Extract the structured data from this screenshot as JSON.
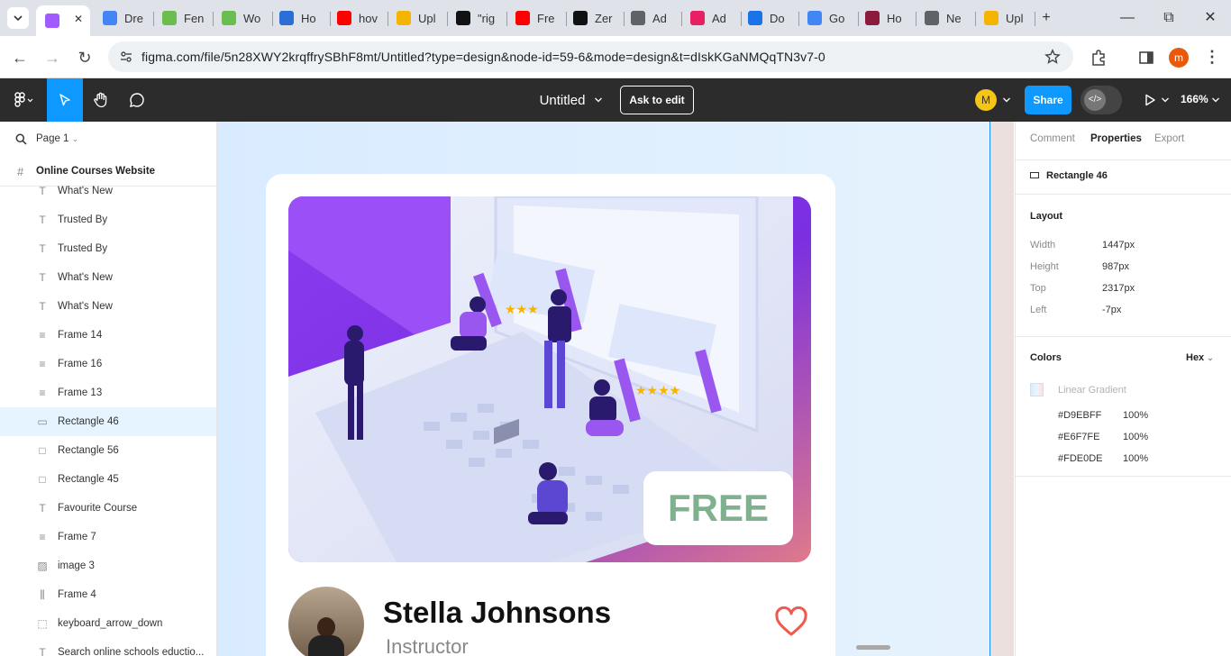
{
  "browser": {
    "tabs": [
      {
        "title": "",
        "color": "#a259ff",
        "active": true
      },
      {
        "title": "Dre",
        "color": "#4285f4"
      },
      {
        "title": "Fen",
        "color": "#6abe4f"
      },
      {
        "title": "Wo",
        "color": "#6abe4f"
      },
      {
        "title": "Ho",
        "color": "#2b6fd6"
      },
      {
        "title": "hov",
        "color": "#ff0000"
      },
      {
        "title": "Upl",
        "color": "#f4b400"
      },
      {
        "title": "\"rig",
        "color": "#111111"
      },
      {
        "title": "Fre",
        "color": "#ff0000"
      },
      {
        "title": "Zer",
        "color": "#111111"
      },
      {
        "title": "Ad",
        "color": "#5f6368"
      },
      {
        "title": "Ad",
        "color": "#e91e63"
      },
      {
        "title": "Do",
        "color": "#1a73e8"
      },
      {
        "title": "Go",
        "color": "#4285f4"
      },
      {
        "title": "Ho",
        "color": "#8b1a3c"
      },
      {
        "title": "Ne",
        "color": "#5f6368"
      },
      {
        "title": "Upl",
        "color": "#f4b400"
      }
    ],
    "url": "figma.com/file/5n28XWY2krqffrySBhF8mt/Untitled?type=design&node-id=59-6&mode=design&t=dIskKGaNMQqTN3v7-0",
    "profile_initial": "m"
  },
  "figma": {
    "file_title": "Untitled",
    "ask_to_edit": "Ask to edit",
    "avatar_initial": "M",
    "share_label": "Share",
    "zoom": "166%"
  },
  "left_panel": {
    "page_name": "Page 1",
    "frame_name": "Online Courses Website",
    "layers": [
      {
        "icon": "T",
        "name": "What's New"
      },
      {
        "icon": "T",
        "name": "Trusted By"
      },
      {
        "icon": "T",
        "name": "Trusted By"
      },
      {
        "icon": "T",
        "name": "What's New"
      },
      {
        "icon": "T",
        "name": "What's New"
      },
      {
        "icon": "≡",
        "name": "Frame 14"
      },
      {
        "icon": "≡",
        "name": "Frame 16"
      },
      {
        "icon": "≡",
        "name": "Frame 13"
      },
      {
        "icon": "▭",
        "name": "Rectangle 46",
        "selected": true
      },
      {
        "icon": "□",
        "name": "Rectangle 56"
      },
      {
        "icon": "□",
        "name": "Rectangle 45"
      },
      {
        "icon": "T",
        "name": "Favourite Course"
      },
      {
        "icon": "≡",
        "name": "Frame 7"
      },
      {
        "icon": "▨",
        "name": "image 3"
      },
      {
        "icon": "⫼",
        "name": "Frame 4"
      },
      {
        "icon": "⬚",
        "name": "keyboard_arrow_down"
      },
      {
        "icon": "T",
        "name": "Search online schools eductio..."
      }
    ]
  },
  "canvas": {
    "badge_text": "FREE",
    "instructor_name": "Stella Johnsons",
    "instructor_role": "Instructor"
  },
  "right_panel": {
    "tabs": [
      "Comment",
      "Properties",
      "Export"
    ],
    "active_tab": "Properties",
    "selection_name": "Rectangle 46",
    "layout_title": "Layout",
    "layout": [
      {
        "label": "Width",
        "value": "1447px"
      },
      {
        "label": "Height",
        "value": "987px"
      },
      {
        "label": "Top",
        "value": "2317px"
      },
      {
        "label": "Left",
        "value": "-7px"
      }
    ],
    "colors_title": "Colors",
    "color_format": "Hex",
    "gradient_label": "Linear Gradient",
    "stops": [
      {
        "hex": "#D9EBFF",
        "opacity": "100%"
      },
      {
        "hex": "#E6F7FE",
        "opacity": "100%"
      },
      {
        "hex": "#FDE0DE",
        "opacity": "100%"
      }
    ]
  }
}
